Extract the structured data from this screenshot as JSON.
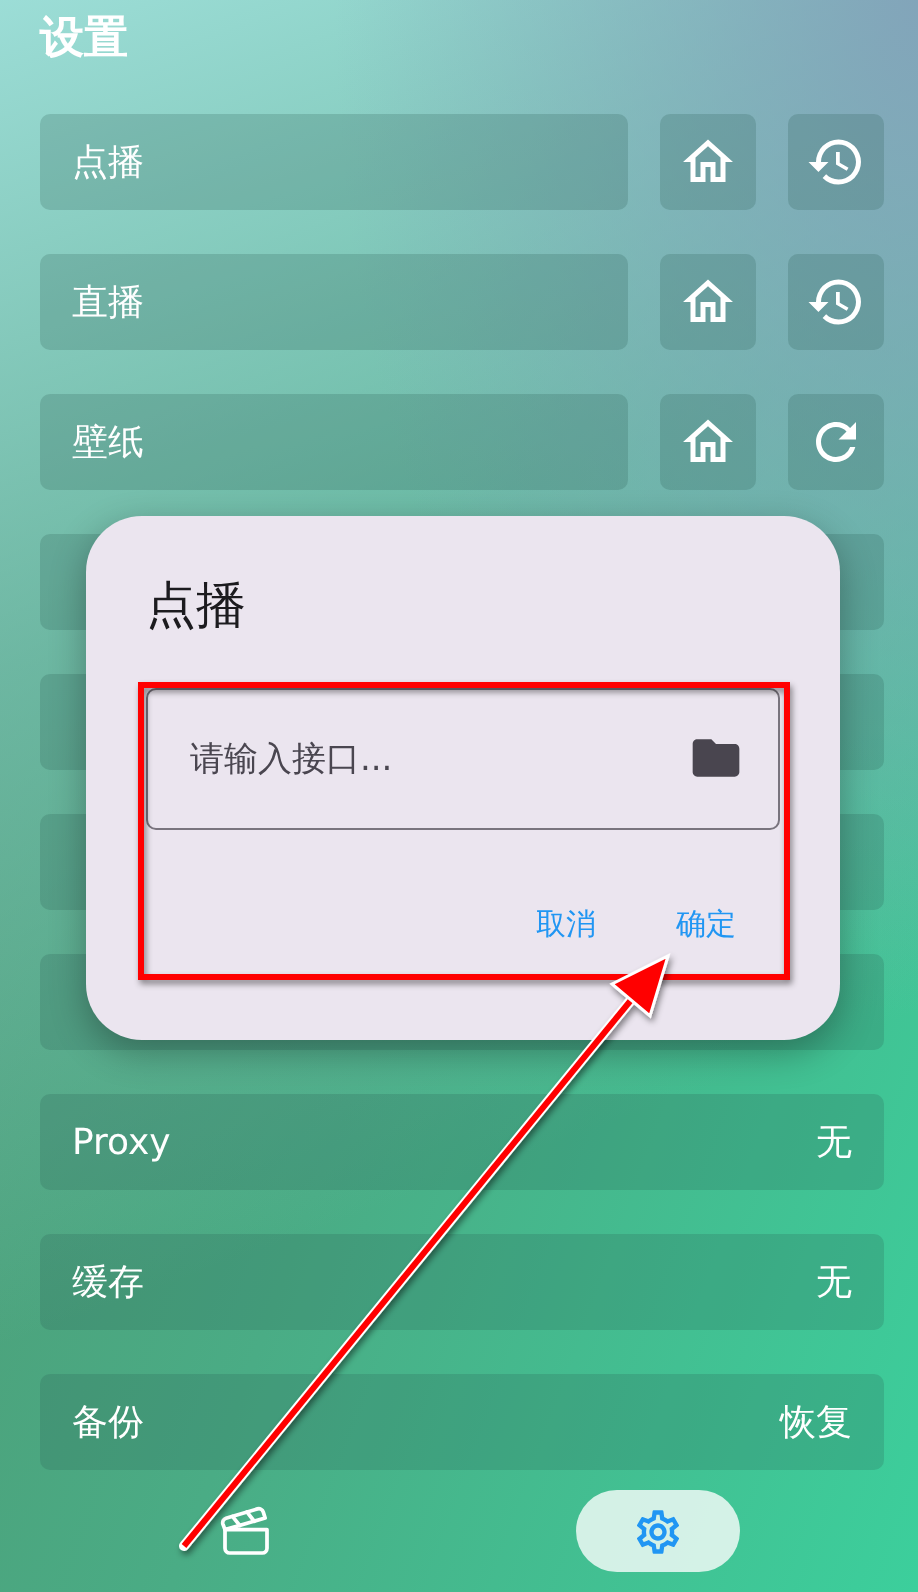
{
  "title": "设置",
  "rows": [
    {
      "kind": "history",
      "label": "点播"
    },
    {
      "kind": "history",
      "label": "直播"
    },
    {
      "kind": "refresh",
      "label": "壁纸"
    },
    {
      "kind": "covered"
    },
    {
      "kind": "covered"
    },
    {
      "kind": "covered"
    },
    {
      "kind": "covered"
    },
    {
      "kind": "value",
      "label": "Proxy",
      "value": "无"
    },
    {
      "kind": "value",
      "label": "缓存",
      "value": "无"
    },
    {
      "kind": "value",
      "label": "备份",
      "value": "恢复"
    }
  ],
  "dialog": {
    "title": "点播",
    "field": {
      "placeholder": "请输入接口..."
    },
    "buttons": [
      "取消",
      "确定"
    ]
  },
  "nav": [
    {
      "kind": "film",
      "selected": false
    },
    {
      "kind": "settings",
      "selected": true
    }
  ]
}
